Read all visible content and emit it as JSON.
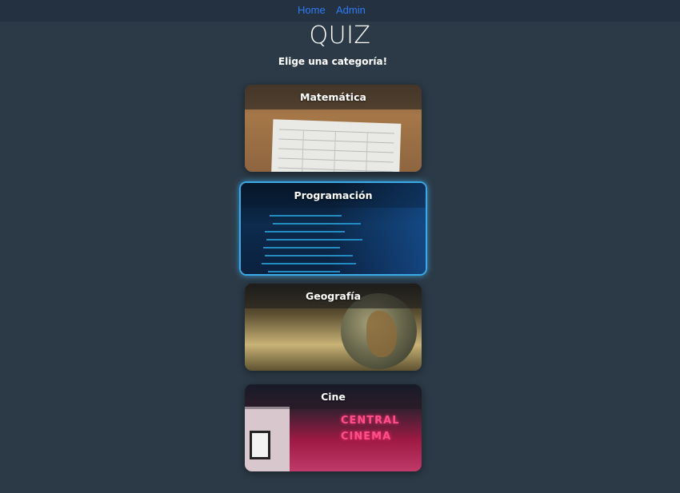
{
  "nav": {
    "home_label": "Home",
    "admin_label": "Admin",
    "link_color": "#2f7cf6"
  },
  "page": {
    "title": "QUIZ",
    "subtitle": "Elige una categoría!"
  },
  "categories": [
    {
      "label": "Matemática",
      "image": "worksheet-photo"
    },
    {
      "label": "Programación",
      "image": "code-screen-photo",
      "selected": true
    },
    {
      "label": "Geografía",
      "image": "globe-map-photo"
    },
    {
      "label": "Cine",
      "image": "cinema-neon-photo"
    }
  ],
  "theme": {
    "background": "#2c3a47",
    "navbar": "#233140",
    "selected_border": "#3ba9e6"
  }
}
